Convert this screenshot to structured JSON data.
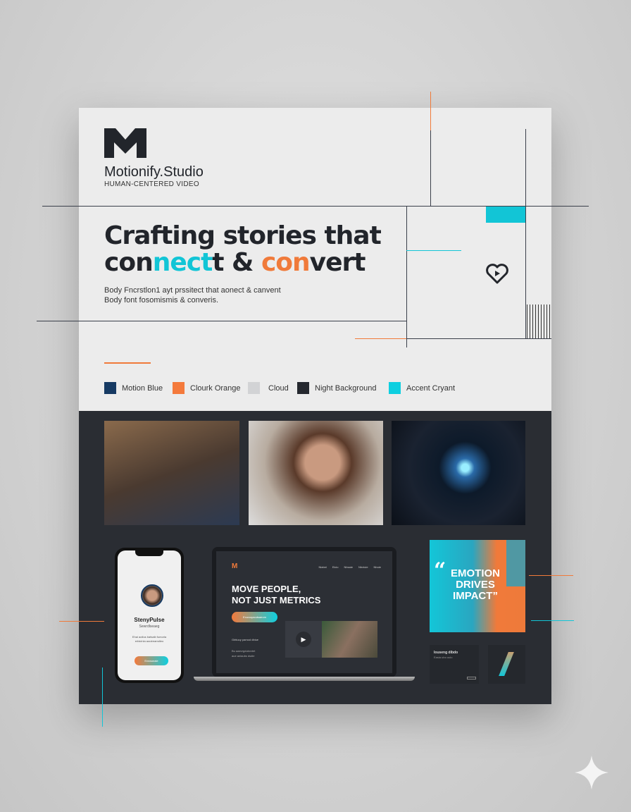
{
  "brand": {
    "name": "Motionify.Studio",
    "tagline": "HUMAN-CENTERED VIDEO"
  },
  "headline": {
    "line1": "Crafting stories that",
    "part_a": "con",
    "part_b": "nect",
    "part_c": "t & ",
    "part_d": "con",
    "part_e": "vert"
  },
  "body_text": {
    "line1": "Body Fncrstlon1 ayt prssitect that aonect & canvent",
    "line2": "Body font fosomismis & converis."
  },
  "palette": [
    {
      "name": "Motion Blue",
      "color": "#163a63"
    },
    {
      "name": "Clourk Orange",
      "color": "#f47a3c"
    },
    {
      "name": "Cloud",
      "color": "#d2d3d5"
    },
    {
      "name": "Night Background",
      "color": "#25282f"
    },
    {
      "name": "Accent Cryant",
      "color": "#0ecfe0"
    }
  ],
  "phone": {
    "title": "StenyPulse",
    "subtitle": "Sewrdlseaeg",
    "text": "Ehai aotlus bafsaib fumorla erbicinla aoutreamdleo",
    "cta": "Eneaunaie"
  },
  "laptop": {
    "nav": [
      "Nlabei",
      "Eicio",
      "Nbsaie",
      "Nbvtuie",
      "Nbuie"
    ],
    "headline1": "MOVE PEOPLE,",
    "headline2": "NOT JUST METRICS",
    "cta": "Exuvuqacutsaeom",
    "sub": "Gbtiuuy pamod dbiue",
    "small1": "Bu aaevrgdubvvtet",
    "small2": "aue aniaubs dsdie"
  },
  "quote": {
    "open": "“",
    "text1": "EMOTION",
    "text2": "DRIVES",
    "text3": "IMPACT",
    "close": "”"
  },
  "mini_card": {
    "title": "Iouseng dibdo",
    "sub": "Easia ubo uulo"
  }
}
